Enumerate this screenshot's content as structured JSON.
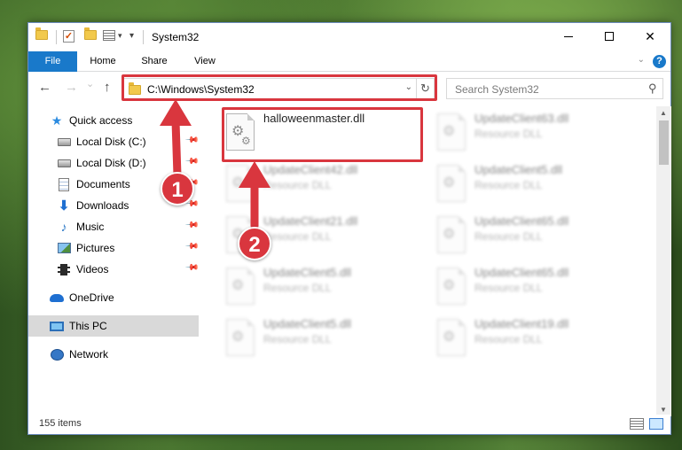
{
  "window": {
    "title": "System32",
    "minimize_glyph": "",
    "maximize_glyph": "",
    "close_glyph": "✕"
  },
  "quick_access_toolbar": {
    "items": [
      "folder-icon",
      "properties-check-icon",
      "new-folder-icon",
      "customize-icon"
    ],
    "dropdown_glyph": "▾"
  },
  "ribbon": {
    "tabs": [
      "File",
      "Home",
      "Share",
      "View"
    ],
    "collapse_glyph": "⌄",
    "help_glyph": "?"
  },
  "navigation": {
    "back_glyph": "←",
    "forward_glyph": "→",
    "recent_glyph": "⌄",
    "up_glyph": "↑",
    "address_path": "C:\\Windows\\System32",
    "address_drop_glyph": "⌄",
    "refresh_glyph": "↻",
    "search_placeholder": "Search System32",
    "search_glyph": "⚲"
  },
  "nav_pane": {
    "items": [
      {
        "label": "Quick access",
        "icon": "star-icon",
        "pinned": false
      },
      {
        "label": "Local Disk (C:)",
        "icon": "disk-icon",
        "pinned": true
      },
      {
        "label": "Local Disk (D:)",
        "icon": "disk-icon",
        "pinned": true
      },
      {
        "label": "Documents",
        "icon": "document-icon",
        "pinned": true
      },
      {
        "label": "Downloads",
        "icon": "download-icon",
        "pinned": true
      },
      {
        "label": "Music",
        "icon": "music-icon",
        "pinned": true
      },
      {
        "label": "Pictures",
        "icon": "pictures-icon",
        "pinned": true
      },
      {
        "label": "Videos",
        "icon": "videos-icon",
        "pinned": true
      },
      {
        "label": "OneDrive",
        "icon": "cloud-icon",
        "pinned": false
      },
      {
        "label": "This PC",
        "icon": "computer-icon",
        "pinned": false
      },
      {
        "label": "Network",
        "icon": "network-icon",
        "pinned": false
      }
    ],
    "selected": "This PC",
    "pin_glyph": "📌",
    "quick_access_glyph": "★",
    "download_glyph": "⬇",
    "music_glyph": "♪"
  },
  "files": [
    {
      "name": "halloweenmaster.dll",
      "type": "",
      "highlighted": true
    },
    {
      "name": "UpdateClient63.dll",
      "type": "Resource DLL",
      "highlighted": false
    },
    {
      "name": "UpdateClient42.dll",
      "type": "Resource DLL",
      "highlighted": false
    },
    {
      "name": "UpdateClient5.dll",
      "type": "Resource DLL",
      "highlighted": false
    },
    {
      "name": "UpdateClient21.dll",
      "type": "Resource DLL",
      "highlighted": false
    },
    {
      "name": "UpdateClient65.dll",
      "type": "Resource DLL",
      "highlighted": false
    },
    {
      "name": "UpdateClient5.dll",
      "type": "Resource DLL",
      "highlighted": false
    },
    {
      "name": "UpdateClient65.dll",
      "type": "Resource DLL",
      "highlighted": false
    },
    {
      "name": "UpdateClient5.dll",
      "type": "Resource DLL",
      "highlighted": false
    },
    {
      "name": "UpdateClient19.dll",
      "type": "Resource DLL",
      "highlighted": false
    }
  ],
  "file_icon_glyph": "⚙",
  "status": {
    "item_count": "155 items"
  },
  "scrollbar": {
    "up_glyph": "▲",
    "down_glyph": "▼"
  },
  "annotations": {
    "callout_1": "1",
    "callout_2": "2",
    "color": "#d9363e"
  }
}
